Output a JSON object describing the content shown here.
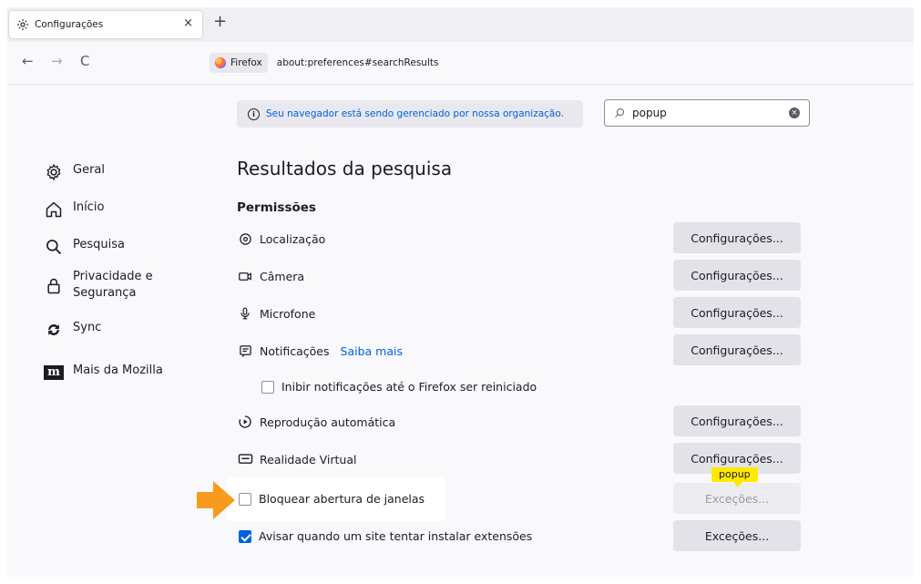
{
  "tab": {
    "title": "Configurações",
    "close": "×",
    "new_tab": "+"
  },
  "nav": {
    "back": "←",
    "forward": "→",
    "reload": "C",
    "identity_label": "Firefox",
    "url": "about:preferences#searchResults"
  },
  "managed_notice": "Seu navegador está sendo gerenciado por nossa organização.",
  "search": {
    "value": "popup",
    "clear": "×"
  },
  "sidebar": {
    "items": [
      {
        "label": "Geral",
        "icon": "gear-icon"
      },
      {
        "label": "Início",
        "icon": "home-icon"
      },
      {
        "label": "Pesquisa",
        "icon": "search-icon"
      },
      {
        "label": "Privacidade e Segurança",
        "label_line1": "Privacidade e",
        "label_line2": "Segurança",
        "icon": "lock-icon"
      },
      {
        "label": "Sync",
        "icon": "sync-icon"
      },
      {
        "label": "Mais da Mozilla",
        "icon": "mozilla-icon",
        "icon_text": "m"
      }
    ]
  },
  "main": {
    "title": "Resultados da pesquisa",
    "section": "Permissões",
    "permissions": [
      {
        "label": "Localização",
        "icon": "location-icon",
        "button": "Configurações..."
      },
      {
        "label": "Câmera",
        "icon": "camera-icon",
        "button": "Configurações..."
      },
      {
        "label": "Microfone",
        "icon": "microphone-icon",
        "button": "Configurações..."
      },
      {
        "label": "Notificações",
        "icon": "notification-icon",
        "link": "Saiba mais",
        "button": "Configurações..."
      },
      {
        "label": "Reprodução automática",
        "icon": "autoplay-icon",
        "button": "Configurações..."
      },
      {
        "label": "Realidade Virtual",
        "icon": "vr-icon",
        "button": "Configurações..."
      }
    ],
    "pause_notifications": {
      "label": "Inibir notificações até o Firefox ser reiniciado",
      "checked": false
    },
    "block_popups": {
      "label": "Bloquear abertura de janelas",
      "checked": false,
      "button": "Exceções...",
      "tooltip": "popup"
    },
    "warn_addons": {
      "label": "Avisar quando um site tentar instalar extensões",
      "checked": true,
      "button": "Exceções..."
    }
  },
  "colors": {
    "accent": "#0061e0",
    "highlight": "#ffe900",
    "arrow": "#f79a1e"
  }
}
